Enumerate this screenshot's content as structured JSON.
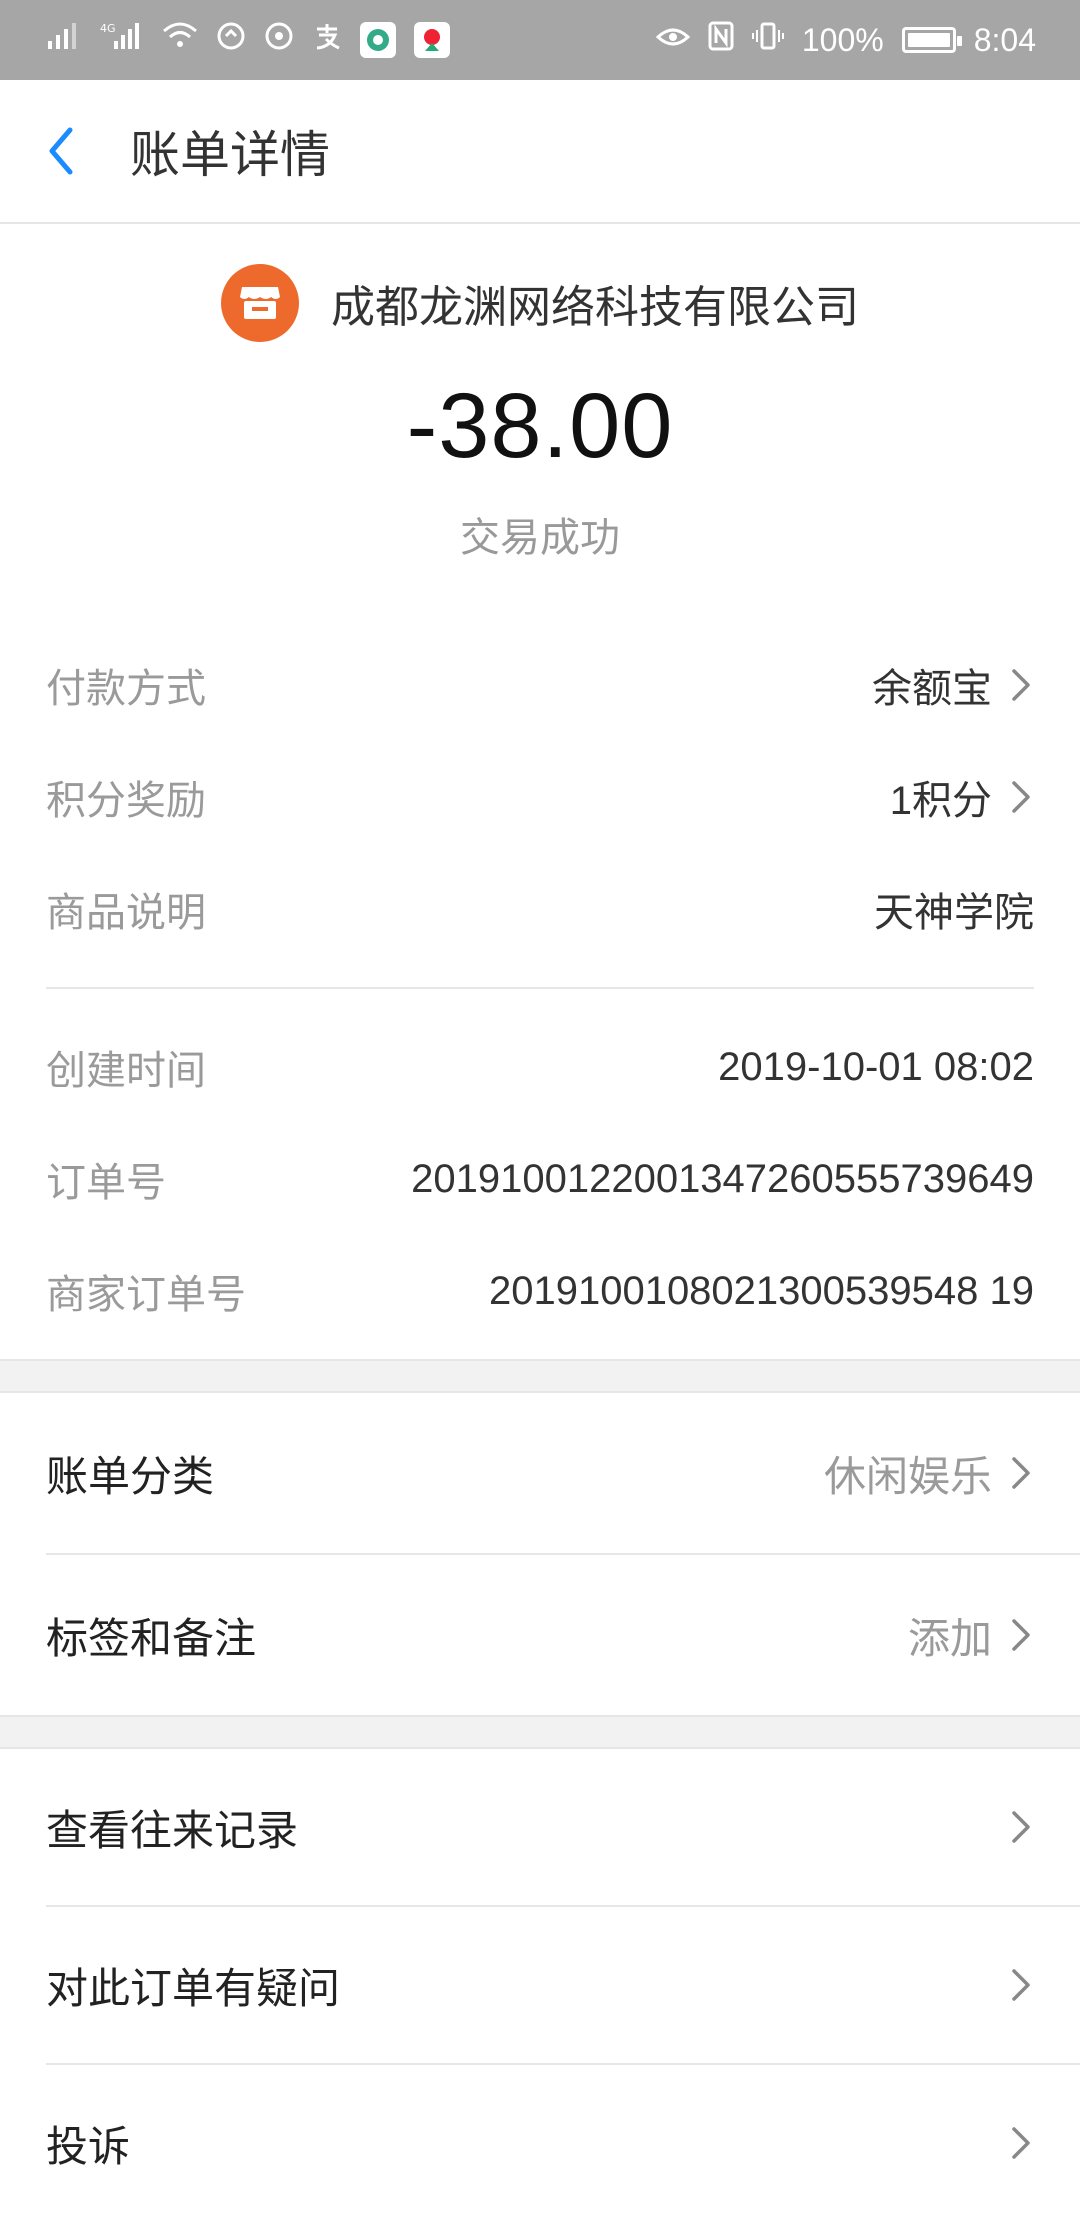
{
  "statusbar": {
    "battery": "100%",
    "time": "8:04",
    "network_labels": [
      "4G"
    ],
    "icons": [
      "signal-icon",
      "4g-signal-icon",
      "wifi-icon",
      "app-icon-1",
      "app-icon-2",
      "alipay-icon",
      "app-icon-3",
      "app-icon-4",
      "eye-icon",
      "nfc-icon",
      "vibrate-icon",
      "battery-icon"
    ],
    "battery_level": 1.0
  },
  "header": {
    "back_icon": "chevron-left-icon",
    "title": "账单详情"
  },
  "summary": {
    "merchant_name": "成都龙渊网络科技有限公司",
    "amount": "-38.00",
    "status": "交易成功",
    "merchant_icon": "shop-icon"
  },
  "details": {
    "payment_method_label": "付款方式",
    "payment_method_value": "余额宝",
    "points_label": "积分奖励",
    "points_value": "1积分",
    "product_label": "商品说明",
    "product_value": "天神学院",
    "created_label": "创建时间",
    "created_value": "2019-10-01 08:02",
    "order_label": "订单号",
    "order_value": "2019100122001347260555739649",
    "merchant_order_label": "商家订单号",
    "merchant_order_value": "2019100108021300539548 19"
  },
  "category": {
    "bill_category_label": "账单分类",
    "bill_category_value": "休闲娱乐",
    "tags_label": "标签和备注",
    "tags_value": "添加"
  },
  "actions": {
    "history_label": "查看往来记录",
    "question_label": "对此订单有疑问",
    "complaint_label": "投诉"
  },
  "colors": {
    "accent": "#1a8cff",
    "merchant_logo": "#ee6a2c",
    "statusbar": "#a6a6a6"
  }
}
